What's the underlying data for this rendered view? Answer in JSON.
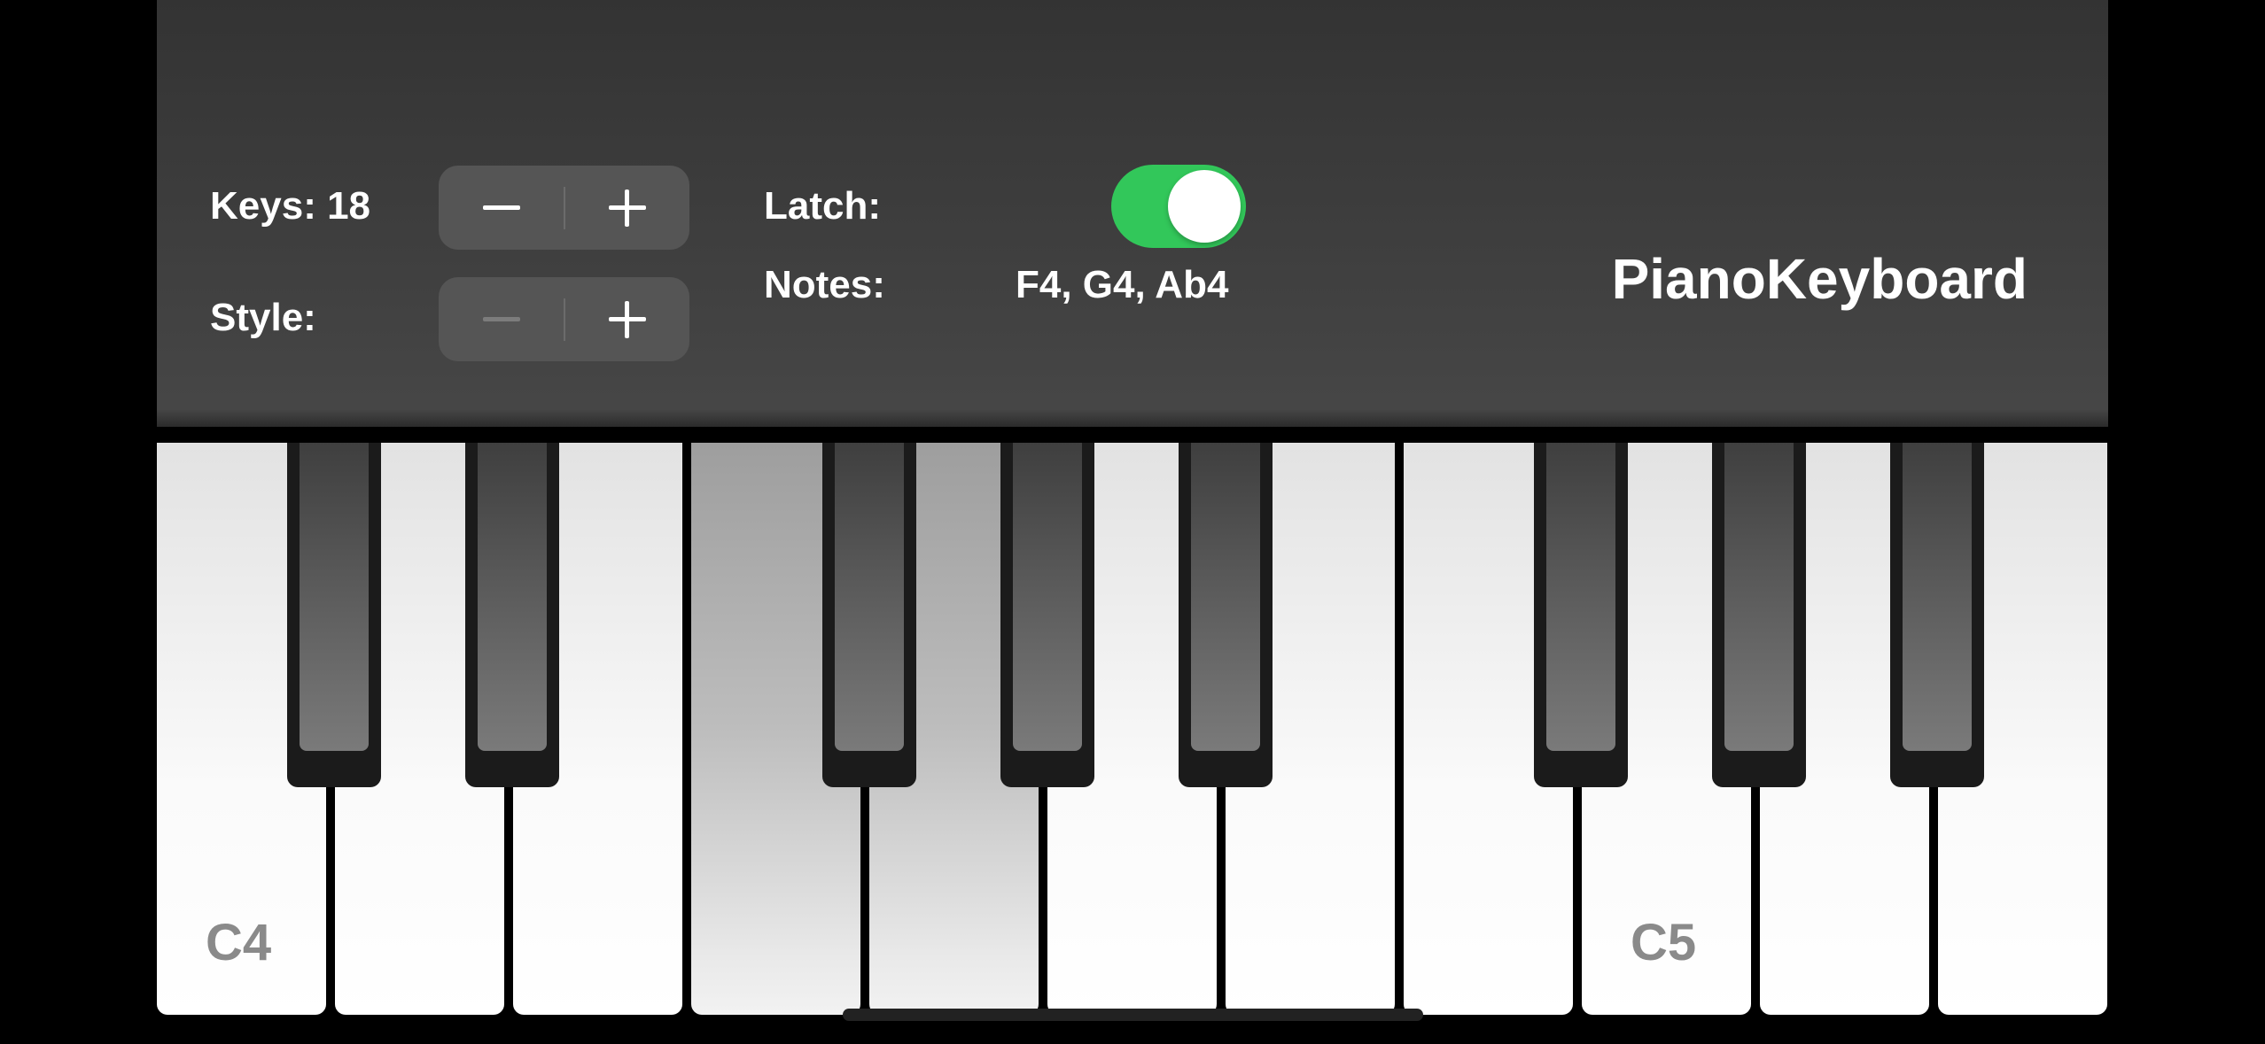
{
  "app_title": "PianoKeyboard",
  "controls": {
    "keys_label": "Keys: 18",
    "style_label": "Style:",
    "latch_label": "Latch:",
    "latch_on": true,
    "notes_label": "Notes:",
    "notes_value": "F4, G4, Ab4"
  },
  "keyboard": {
    "white_keys": [
      {
        "label": "C4",
        "pressed": false
      },
      {
        "label": "",
        "pressed": false
      },
      {
        "label": "",
        "pressed": false
      },
      {
        "label": "",
        "pressed": true
      },
      {
        "label": "",
        "pressed": true
      },
      {
        "label": "",
        "pressed": false
      },
      {
        "label": "",
        "pressed": false
      },
      {
        "label": "",
        "pressed": false
      },
      {
        "label": "C5",
        "pressed": false
      },
      {
        "label": "",
        "pressed": false
      },
      {
        "label": "",
        "pressed": false
      },
      {
        "label": "",
        "pressed": false
      }
    ],
    "black_key_count": 8
  },
  "colors": {
    "toggle_on": "#32c75a",
    "header_bg": "#3e3e3e",
    "stepper_bg": "#555555"
  }
}
